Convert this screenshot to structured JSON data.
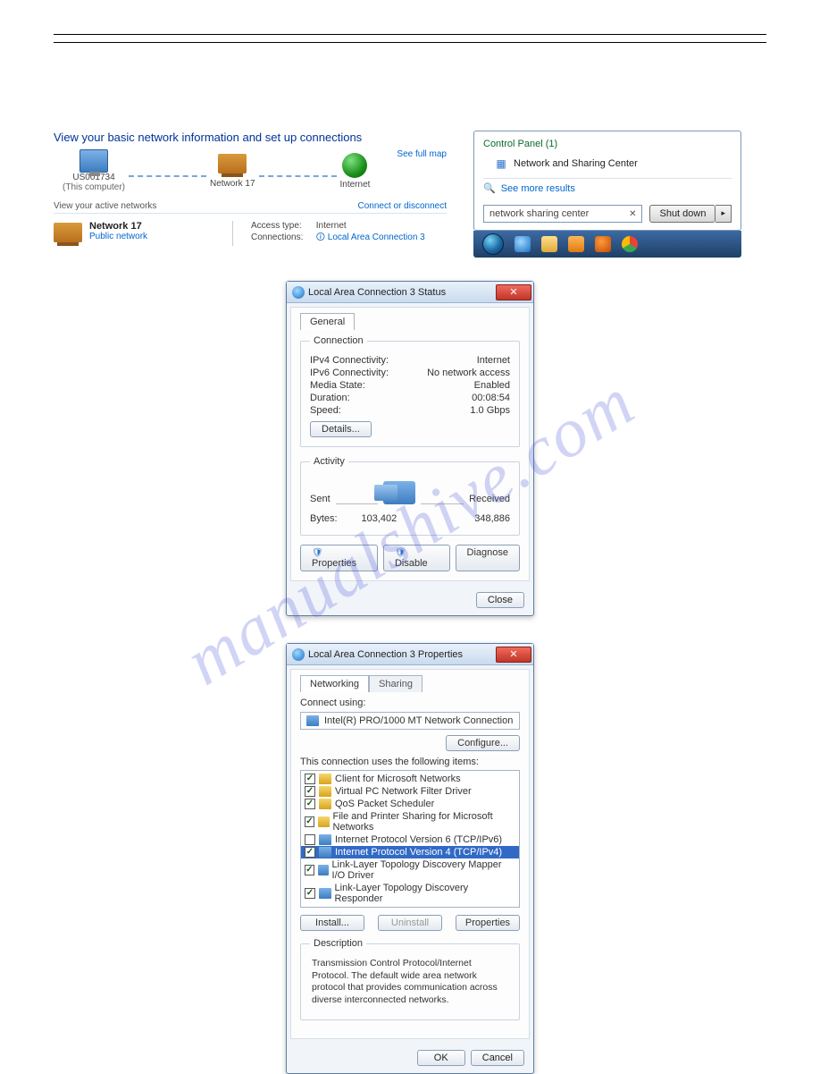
{
  "watermark": "manualshive.com",
  "netcenter": {
    "title": "View your basic network information and set up connections",
    "see_full_map": "See full map",
    "nodes": {
      "computer": "US001734",
      "computer_sub": "(This computer)",
      "network": "Network 17",
      "internet": "Internet"
    },
    "active_label": "View your active networks",
    "connect_disc": "Connect or disconnect",
    "network_name": "Network 17",
    "network_type": "Public network",
    "access_type_lbl": "Access type:",
    "access_type_val": "Internet",
    "connections_lbl": "Connections:",
    "connections_val": "Local Area Connection 3"
  },
  "start": {
    "cp_heading": "Control Panel (1)",
    "cp_item": "Network and Sharing Center",
    "see_more": "See more results",
    "search_value": "network sharing center",
    "shutdown": "Shut down"
  },
  "status": {
    "title": "Local Area Connection 3 Status",
    "tab_general": "General",
    "grp_conn": "Connection",
    "ipv4_lbl": "IPv4 Connectivity:",
    "ipv4_val": "Internet",
    "ipv6_lbl": "IPv6 Connectivity:",
    "ipv6_val": "No network access",
    "media_lbl": "Media State:",
    "media_val": "Enabled",
    "dur_lbl": "Duration:",
    "dur_val": "00:08:54",
    "speed_lbl": "Speed:",
    "speed_val": "1.0 Gbps",
    "details_btn": "Details...",
    "grp_act": "Activity",
    "sent_lbl": "Sent",
    "recv_lbl": "Received",
    "bytes_lbl": "Bytes:",
    "bytes_sent": "103,402",
    "bytes_recv": "348,886",
    "properties_btn": "Properties",
    "disable_btn": "Disable",
    "diagnose_btn": "Diagnose",
    "close_btn": "Close"
  },
  "props": {
    "title": "Local Area Connection 3 Properties",
    "tab_net": "Networking",
    "tab_share": "Sharing",
    "connect_using_lbl": "Connect using:",
    "adapter": "Intel(R) PRO/1000 MT Network Connection",
    "configure_btn": "Configure...",
    "uses_lbl": "This connection uses the following items:",
    "items": [
      {
        "checked": true,
        "icon": "a",
        "label": "Client for Microsoft Networks"
      },
      {
        "checked": true,
        "icon": "a",
        "label": "Virtual PC Network Filter Driver"
      },
      {
        "checked": true,
        "icon": "a",
        "label": "QoS Packet Scheduler"
      },
      {
        "checked": true,
        "icon": "a",
        "label": "File and Printer Sharing for Microsoft Networks"
      },
      {
        "checked": false,
        "icon": "b",
        "label": "Internet Protocol Version 6 (TCP/IPv6)"
      },
      {
        "checked": true,
        "icon": "b",
        "label": "Internet Protocol Version 4 (TCP/IPv4)",
        "selected": true
      },
      {
        "checked": true,
        "icon": "b",
        "label": "Link-Layer Topology Discovery Mapper I/O Driver"
      },
      {
        "checked": true,
        "icon": "b",
        "label": "Link-Layer Topology Discovery Responder"
      }
    ],
    "install_btn": "Install...",
    "uninstall_btn": "Uninstall",
    "properties_btn": "Properties",
    "desc_grp": "Description",
    "desc_text": "Transmission Control Protocol/Internet Protocol. The default wide area network protocol that provides communication across diverse interconnected networks.",
    "ok_btn": "OK",
    "cancel_btn": "Cancel"
  }
}
